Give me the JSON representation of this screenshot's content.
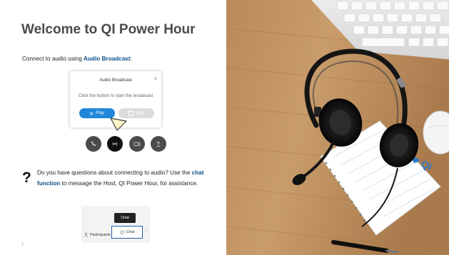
{
  "slide": {
    "title": "Welcome to QI Power Hour",
    "connect_prefix": "Connect to audio using ",
    "connect_bold": "Audio Broadcast",
    "connect_suffix": ":",
    "question_prefix": "Do you have questions about connecting to audio? Use the ",
    "question_bold": "chat function",
    "question_suffix": " to message the Host, QI Power Hour, for assistance.",
    "question_mark": "?",
    "slide_number": "2"
  },
  "dialog": {
    "title": "Audio Broadcast",
    "close": "×",
    "body": "Click the button to start the broadcast",
    "play_label": "Play",
    "stop_label": "Stop"
  },
  "chat_panel": {
    "tooltip": "Chat",
    "participants_label": "Participants",
    "chat_label": "Chat",
    "more": "···"
  },
  "photo": {
    "notepad_text": "I ❤ QI"
  },
  "colors": {
    "title": "#4a4a4a",
    "link_blue": "#0b4f8a",
    "play_blue": "#1f86d9",
    "chat_border": "#1f5fb0"
  }
}
